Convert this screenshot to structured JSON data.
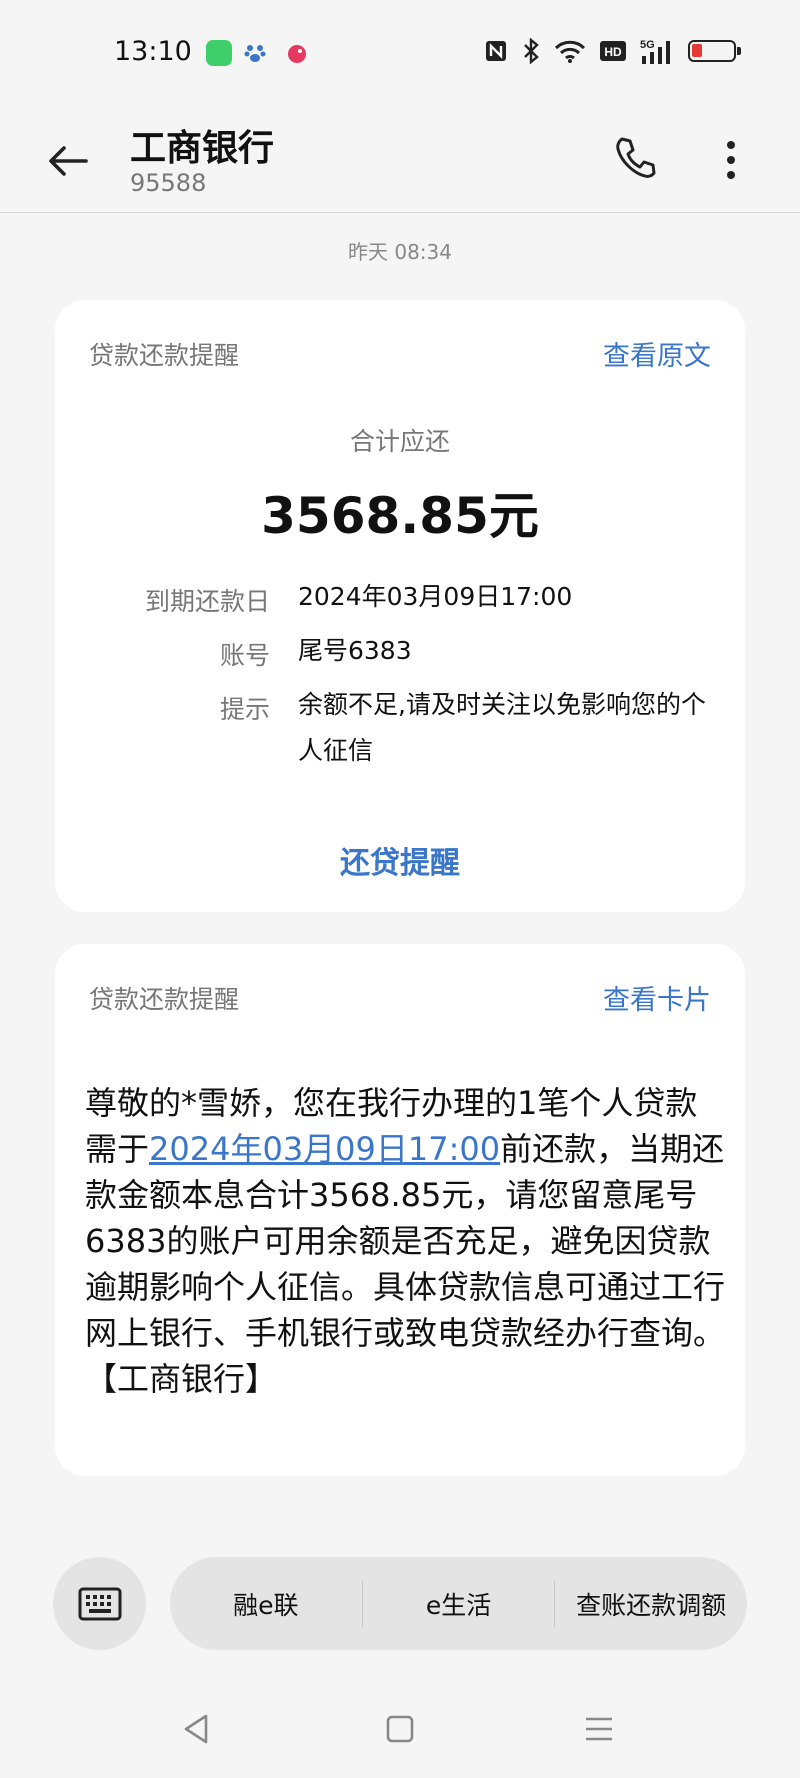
{
  "status_bar": {
    "time": "13:10",
    "colors": {
      "battery_level": "#e53935",
      "app_green": "#3ecf6a"
    }
  },
  "header": {
    "title": "工商银行",
    "number": "95588"
  },
  "conversation": {
    "timestamp": "昨天 08:34"
  },
  "card1": {
    "label": "贷款还款提醒",
    "link": "查看原文",
    "sum_label": "合计应还",
    "amount": "3568.85元",
    "rows": [
      {
        "label": "到期还款日",
        "value": "2024年03月09日17:00"
      },
      {
        "label": "账号",
        "value": "尾号6383"
      },
      {
        "label": "提示",
        "value": "余额不足,请及时关注以免影响您的个人征信"
      }
    ],
    "action": "还贷提醒"
  },
  "card2": {
    "label": "贷款还款提醒",
    "link": "查看卡片",
    "message_prefix": "尊敬的*雪娇，您在我行办理的1笔个人贷款需于",
    "message_link": "2024年03月09日17:00",
    "message_suffix": "前还款，当期还款金额本息合计3568.85元，请您留意尾号6383的账户可用余额是否充足，避免因贷款逾期影响个人征信。具体贷款信息可通过工行网上银行、手机银行或致电贷款经办行查询。【工商银行】"
  },
  "bottom_menu": {
    "items": [
      "融e联",
      "e生活",
      "查账还款调额"
    ]
  },
  "theme": {
    "accent": "#3a76c9",
    "background": "#f5f5f5",
    "card": "#ffffff"
  }
}
